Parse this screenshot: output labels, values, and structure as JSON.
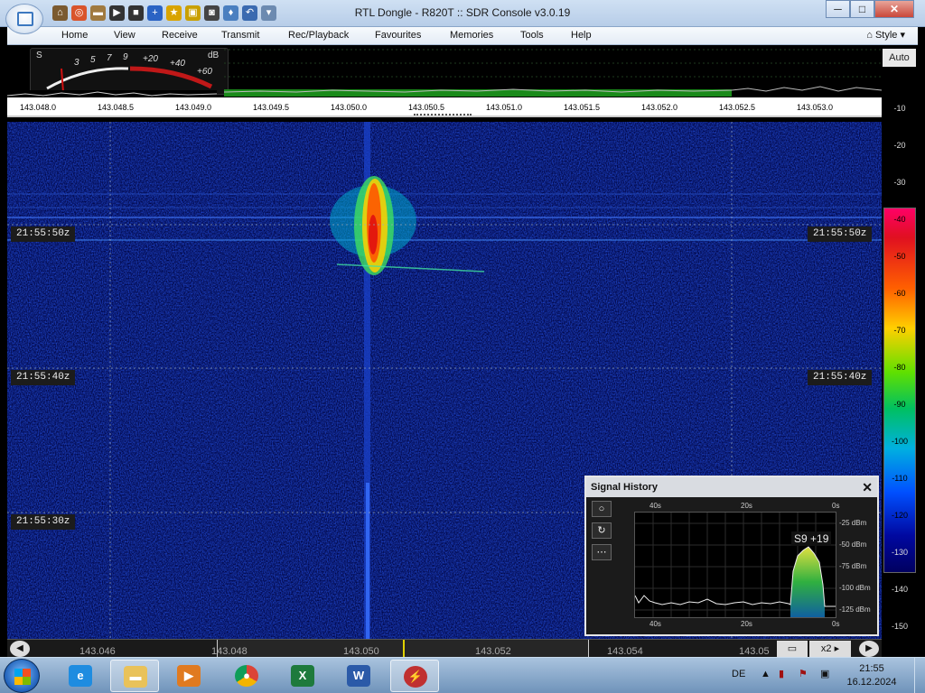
{
  "window": {
    "title": "RTL Dongle - R820T :: SDR Console v3.0.19",
    "minimize": "─",
    "maximize": "□",
    "close": "✕"
  },
  "menu": {
    "items": [
      "Home",
      "View",
      "Receive",
      "Transmit",
      "Rec/Playback",
      "Favourites",
      "Memories",
      "Tools",
      "Help"
    ],
    "style": "Style"
  },
  "smeter": {
    "unit_s": "S",
    "unit_db": "dB",
    "scale": [
      "3",
      "5",
      "7",
      "9",
      "+20",
      "+40",
      "+60"
    ]
  },
  "frequency_axis": [
    "143.048.0",
    "143.048.5",
    "143.049.0",
    "143.049.5",
    "143.050.0",
    "143.050.5",
    "143.051.0",
    "143.051.5",
    "143.052.0",
    "143.052.5",
    "143.053.0"
  ],
  "waterfall": {
    "times": [
      "21:55:50z",
      "21:55:40z",
      "21:55:30z"
    ]
  },
  "scale": {
    "auto": "Auto",
    "ticks": [
      "-10",
      "-20",
      "-30",
      "-40",
      "-50",
      "-60",
      "-70",
      "-80",
      "-90",
      "-100",
      "-110",
      "-120",
      "-130",
      "-140",
      "-150"
    ]
  },
  "bottom": {
    "ticks": [
      "143.046",
      "143.048",
      "143.050",
      "143.052",
      "143.054",
      "143.05"
    ],
    "zoom": "x2",
    "left_nav": "◀",
    "right_nav": "▶"
  },
  "signal_history": {
    "title": "Signal History",
    "close": "✕",
    "time_top": [
      "40s",
      "20s",
      "0s"
    ],
    "time_bottom": [
      "40s",
      "20s",
      "0s"
    ],
    "levels": [
      "-25 dBm",
      "-50 dBm",
      "-75 dBm",
      "-100 dBm",
      "-125 dBm"
    ],
    "badge": "S9 +19",
    "buttons": [
      "○",
      "↻",
      "⋯"
    ]
  },
  "taskbar": {
    "lang": "DE",
    "time": "21:55",
    "date": "16.12.2024",
    "apps": [
      "Internet Explorer",
      "Explorer",
      "Media Player",
      "Chrome",
      "Excel",
      "Word",
      "SDR Console"
    ]
  }
}
